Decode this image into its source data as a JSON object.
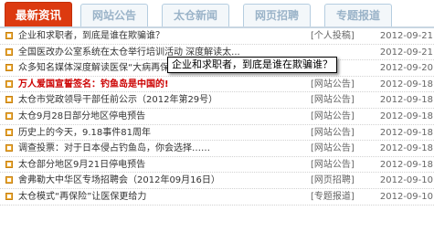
{
  "tabs": [
    "最新资讯",
    "网站公告",
    "太仓新闻",
    "网页招聘",
    "专题报道"
  ],
  "items": [
    {
      "title": "企业和求职者，到底是谁在欺骗谁？",
      "category": "[个人投稿]",
      "date": "2012-09-21",
      "highlight": false
    },
    {
      "title": "全国医改办公室系统在太仓举行培训活动 深度解读太...",
      "category": "",
      "date": "2012-09-21",
      "highlight": false
    },
    {
      "title": "众多知名媒体深度解读医保“大病再保险”，“太仓...",
      "category": "",
      "date": "2012-09-20",
      "highlight": false
    },
    {
      "title": "万人爱国宣誓签名：钓鱼岛是中国的!",
      "category": "[网站公告]",
      "date": "2012-09-18",
      "highlight": true
    },
    {
      "title": "太仓市党政领导干部任前公示（2012年第29号）",
      "category": "[网站公告]",
      "date": "2012-09-18",
      "highlight": false
    },
    {
      "title": "太仓9月28日部分地区停电预告",
      "category": "[网站公告]",
      "date": "2012-09-18",
      "highlight": false
    },
    {
      "title": "历史上的今天，9.18事件81周年",
      "category": "[网站公告]",
      "date": "2012-09-18",
      "highlight": false
    },
    {
      "title": "调查投票：对于日本侵占钓鱼岛，你会选择……",
      "category": "[网站公告]",
      "date": "2012-09-18",
      "highlight": false
    },
    {
      "title": "太仓部分地区9月21日停电预告",
      "category": "[网站公告]",
      "date": "2012-09-18",
      "highlight": false
    },
    {
      "title": "舍弗勒大中华区专场招聘会（2012年09月16日）",
      "category": "[网页招聘]",
      "date": "2012-09-10",
      "highlight": false
    },
    {
      "title": "太仓模式“再保险”让医保更给力",
      "category": "[专题报道]",
      "date": "2012-09-10",
      "highlight": false
    }
  ],
  "tooltip": "企业和求职者，到底是谁在欺骗谁？"
}
